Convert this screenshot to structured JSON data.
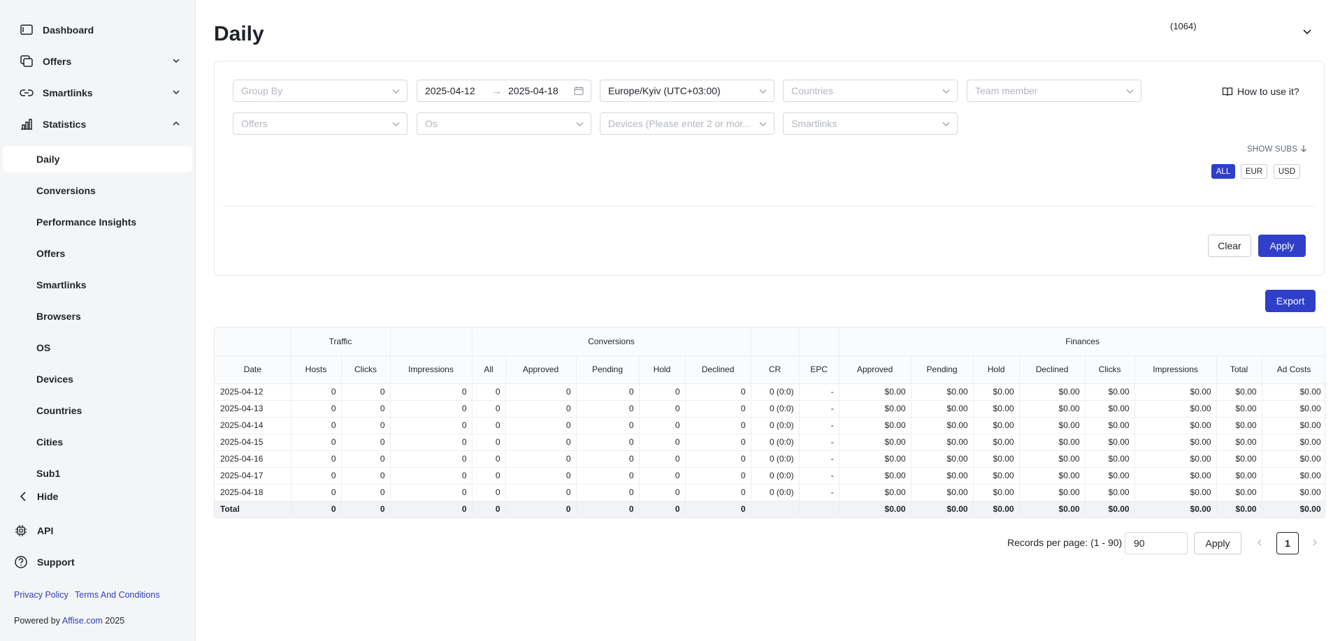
{
  "sidebar": {
    "nav": [
      {
        "label": "Dashboard",
        "icon": "dashboard-icon"
      },
      {
        "label": "Offers",
        "icon": "offers-icon"
      },
      {
        "label": "Smartlinks",
        "icon": "link-icon"
      },
      {
        "label": "Statistics",
        "icon": "chart-icon"
      }
    ],
    "stats_items": [
      "Daily",
      "Conversions",
      "Performance Insights",
      "Offers",
      "Smartlinks",
      "Browsers",
      "OS",
      "Devices",
      "Countries",
      "Cities",
      "Sub1"
    ],
    "hide_label": "Hide",
    "api_label": "API",
    "support_label": "Support",
    "privacy_label": "Privacy Policy",
    "terms_label": "Terms And Conditions",
    "powered_prefix": "Powered by",
    "powered_link": "Affise.com",
    "powered_year": "2025"
  },
  "header": {
    "title": "Daily",
    "user_count": "(1064)"
  },
  "filters": {
    "group_by_placeholder": "Group By",
    "date_from": "2025-04-12",
    "date_to": "2025-04-18",
    "date_sep": "→",
    "timezone": "Europe/Kyiv (UTC+03:00)",
    "countries_placeholder": "Countries",
    "team_member_placeholder": "Team member",
    "offers_placeholder": "Offers",
    "os_placeholder": "Os",
    "devices_placeholder": "Devices (Please enter 2 or mor...",
    "smartlinks_placeholder": "Smartlinks",
    "how_to_use": "How to use it?",
    "show_subs": "SHOW SUBS",
    "currencies": [
      "ALL",
      "EUR",
      "USD"
    ],
    "clear_label": "Clear",
    "apply_label": "Apply"
  },
  "export_label": "Export",
  "table": {
    "groups": [
      {
        "label": "",
        "span": 1
      },
      {
        "label": "Traffic",
        "span": 2
      },
      {
        "label": "",
        "span": 1
      },
      {
        "label": "Conversions",
        "span": 5
      },
      {
        "label": "",
        "span": 1
      },
      {
        "label": "",
        "span": 1
      },
      {
        "label": "Finances",
        "span": 8
      }
    ],
    "columns": [
      "Date",
      "Hosts",
      "Clicks",
      "Impressions",
      "All",
      "Approved",
      "Pending",
      "Hold",
      "Declined",
      "CR",
      "EPC",
      "Approved",
      "Pending",
      "Hold",
      "Declined",
      "Clicks",
      "Impressions",
      "Total",
      "Ad Costs"
    ],
    "rows": [
      [
        "2025-04-12",
        "0",
        "0",
        "0",
        "0",
        "0",
        "0",
        "0",
        "0",
        "0 (0:0)",
        "-",
        "$0.00",
        "$0.00",
        "$0.00",
        "$0.00",
        "$0.00",
        "$0.00",
        "$0.00",
        "$0.00"
      ],
      [
        "2025-04-13",
        "0",
        "0",
        "0",
        "0",
        "0",
        "0",
        "0",
        "0",
        "0 (0:0)",
        "-",
        "$0.00",
        "$0.00",
        "$0.00",
        "$0.00",
        "$0.00",
        "$0.00",
        "$0.00",
        "$0.00"
      ],
      [
        "2025-04-14",
        "0",
        "0",
        "0",
        "0",
        "0",
        "0",
        "0",
        "0",
        "0 (0:0)",
        "-",
        "$0.00",
        "$0.00",
        "$0.00",
        "$0.00",
        "$0.00",
        "$0.00",
        "$0.00",
        "$0.00"
      ],
      [
        "2025-04-15",
        "0",
        "0",
        "0",
        "0",
        "0",
        "0",
        "0",
        "0",
        "0 (0:0)",
        "-",
        "$0.00",
        "$0.00",
        "$0.00",
        "$0.00",
        "$0.00",
        "$0.00",
        "$0.00",
        "$0.00"
      ],
      [
        "2025-04-16",
        "0",
        "0",
        "0",
        "0",
        "0",
        "0",
        "0",
        "0",
        "0 (0:0)",
        "-",
        "$0.00",
        "$0.00",
        "$0.00",
        "$0.00",
        "$0.00",
        "$0.00",
        "$0.00",
        "$0.00"
      ],
      [
        "2025-04-17",
        "0",
        "0",
        "0",
        "0",
        "0",
        "0",
        "0",
        "0",
        "0 (0:0)",
        "-",
        "$0.00",
        "$0.00",
        "$0.00",
        "$0.00",
        "$0.00",
        "$0.00",
        "$0.00",
        "$0.00"
      ],
      [
        "2025-04-18",
        "0",
        "0",
        "0",
        "0",
        "0",
        "0",
        "0",
        "0",
        "0 (0:0)",
        "-",
        "$0.00",
        "$0.00",
        "$0.00",
        "$0.00",
        "$0.00",
        "$0.00",
        "$0.00",
        "$0.00"
      ]
    ],
    "total": [
      "Total",
      "0",
      "0",
      "0",
      "0",
      "0",
      "0",
      "0",
      "0",
      "",
      "",
      "$0.00",
      "$0.00",
      "$0.00",
      "$0.00",
      "$0.00",
      "$0.00",
      "$0.00",
      "$0.00"
    ]
  },
  "pagination": {
    "records_label": "Records per page: (1 - 90)",
    "per_page_value": "90",
    "apply_label": "Apply",
    "current_page": "1"
  },
  "colors": {
    "accent": "#2f3fc9",
    "link": "#2f3fb9"
  }
}
